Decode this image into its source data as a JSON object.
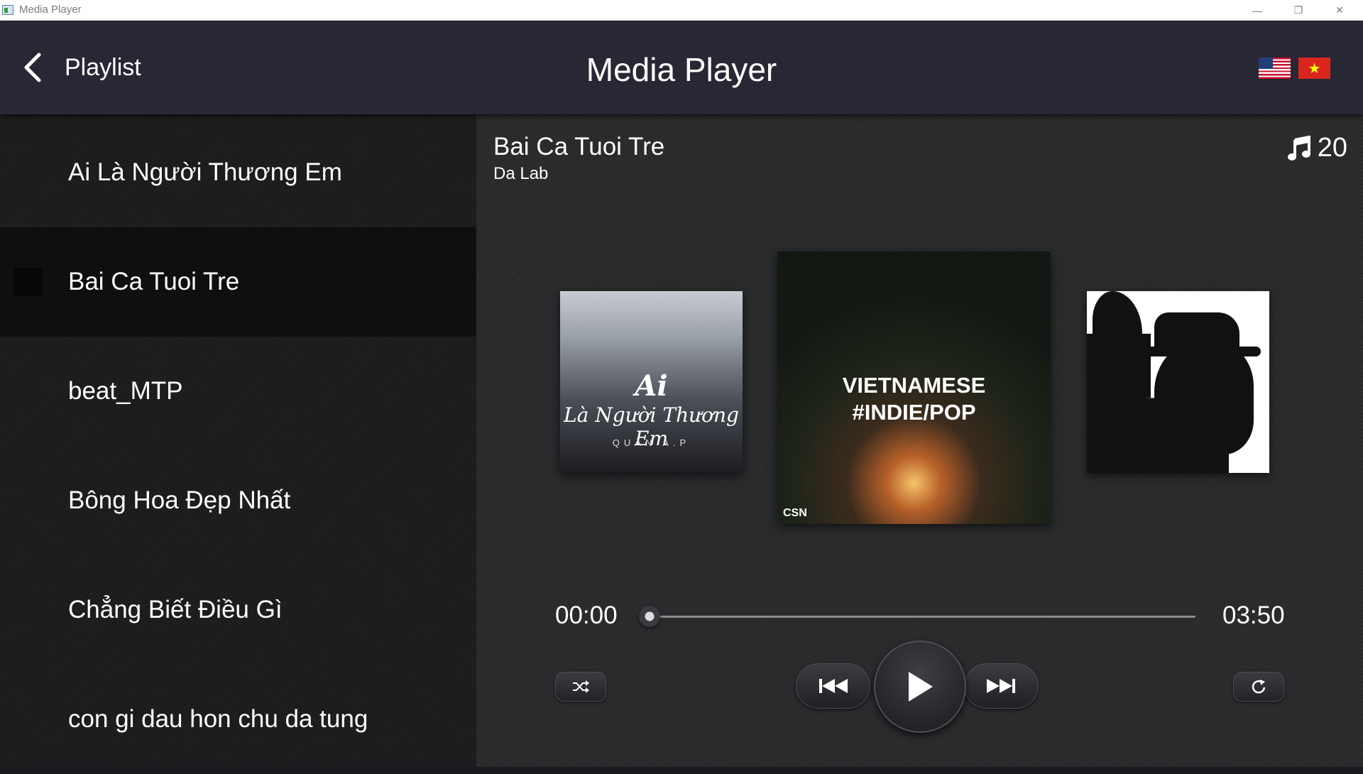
{
  "window": {
    "title": "Media Player",
    "minimize": "—",
    "maximize": "❐",
    "close": "✕"
  },
  "header": {
    "back_label": "Playlist",
    "title": "Media Player",
    "flags": [
      "us-flag-icon",
      "vietnam-flag-icon"
    ],
    "vn_star": "★"
  },
  "playlist": {
    "items": [
      {
        "label": "Ai Là Người Thương Em",
        "selected": false
      },
      {
        "label": "Bai Ca Tuoi Tre",
        "selected": true
      },
      {
        "label": "beat_MTP",
        "selected": false
      },
      {
        "label": "Bông Hoa Đẹp Nhất",
        "selected": false
      },
      {
        "label": "Chẳng Biết Điều Gì",
        "selected": false
      },
      {
        "label": "con gi dau hon chu da tung",
        "selected": false
      }
    ]
  },
  "now_playing": {
    "title": "Bai Ca Tuoi Tre",
    "artist": "Da Lab",
    "song_count": "20",
    "count_icon": "music-note-icon"
  },
  "artwork": {
    "left": {
      "line1": "Ai",
      "line2": "Là Người Thương Em",
      "line3": "QUÂN A.P"
    },
    "center": {
      "line1": "VIETNAMESE",
      "line2": "#INDIE/POP",
      "watermark": "CSN"
    },
    "right": {}
  },
  "progress": {
    "current": "00:00",
    "total": "03:50",
    "fraction": 0.0
  },
  "controls": {
    "shuffle": "shuffle-icon",
    "previous": "skip-previous-icon",
    "play": "play-icon",
    "next": "skip-next-icon",
    "repeat": "repeat-icon"
  },
  "colors": {
    "header_bg": "#272833",
    "sidebar_bg": "#1c1d1f",
    "selected_bg": "#0f0f10",
    "main_bg": "#2a2b2d",
    "track": "#8b8b8b"
  }
}
